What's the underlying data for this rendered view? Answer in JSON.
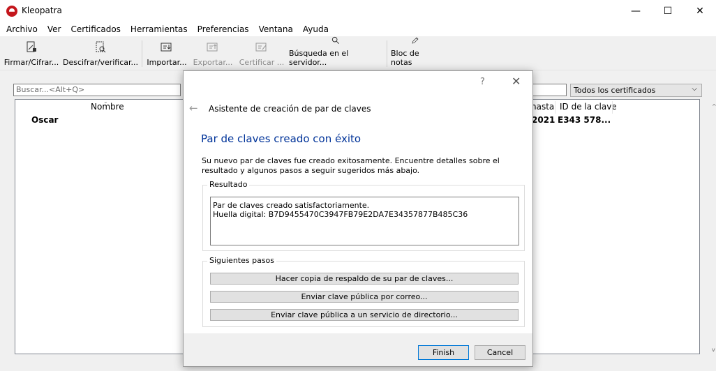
{
  "window": {
    "title": "Kleopatra",
    "minimize": "—",
    "maximize": "☐",
    "close": "✕"
  },
  "menu": [
    "Archivo",
    "Ver",
    "Certificados",
    "Herramientas",
    "Preferencias",
    "Ventana",
    "Ayuda"
  ],
  "toolbar": {
    "sign_encrypt": "Firmar/Cifrar...",
    "decrypt_verify": "Descifrar/verificar...",
    "import": "Importar...",
    "export": "Exportar...",
    "certify": "Certificar ...",
    "server_search": "Búsqueda en el servidor...",
    "notepad": "Bloc de notas"
  },
  "search": {
    "placeholder": "Buscar...<Alt+Q>"
  },
  "filter": {
    "selected": "Todos los certificados"
  },
  "cert_list": {
    "col_name": "Nombre",
    "col_until": "hasta",
    "col_keyid": "ID de la clave",
    "row": {
      "name": "Oscar",
      "until": "2021",
      "keyid": "E343 578..."
    }
  },
  "dialog": {
    "help": "?",
    "close": "✕",
    "back": "←",
    "wizard_title": "Asistente de creación de par de claves",
    "page_title": "Par de claves creado con éxito",
    "intro": "Su nuevo par de claves fue creado exitosamente. Encuentre detalles sobre el resultado y algunos pasos a seguir sugeridos más abajo.",
    "result_label": "Resultado",
    "result_line1": "Par de claves creado satisfactoriamente.",
    "result_line2": "Huella digital: B7D9455470C3947FB79E2DA7E34357877B485C36",
    "next_steps_label": "Siguientes pasos",
    "step_backup": "Hacer copia de respaldo de su par de claves...",
    "step_email": "Enviar clave pública por correo...",
    "step_directory": "Enviar clave pública a un servicio de directorio...",
    "finish": "Finish",
    "cancel": "Cancel"
  }
}
